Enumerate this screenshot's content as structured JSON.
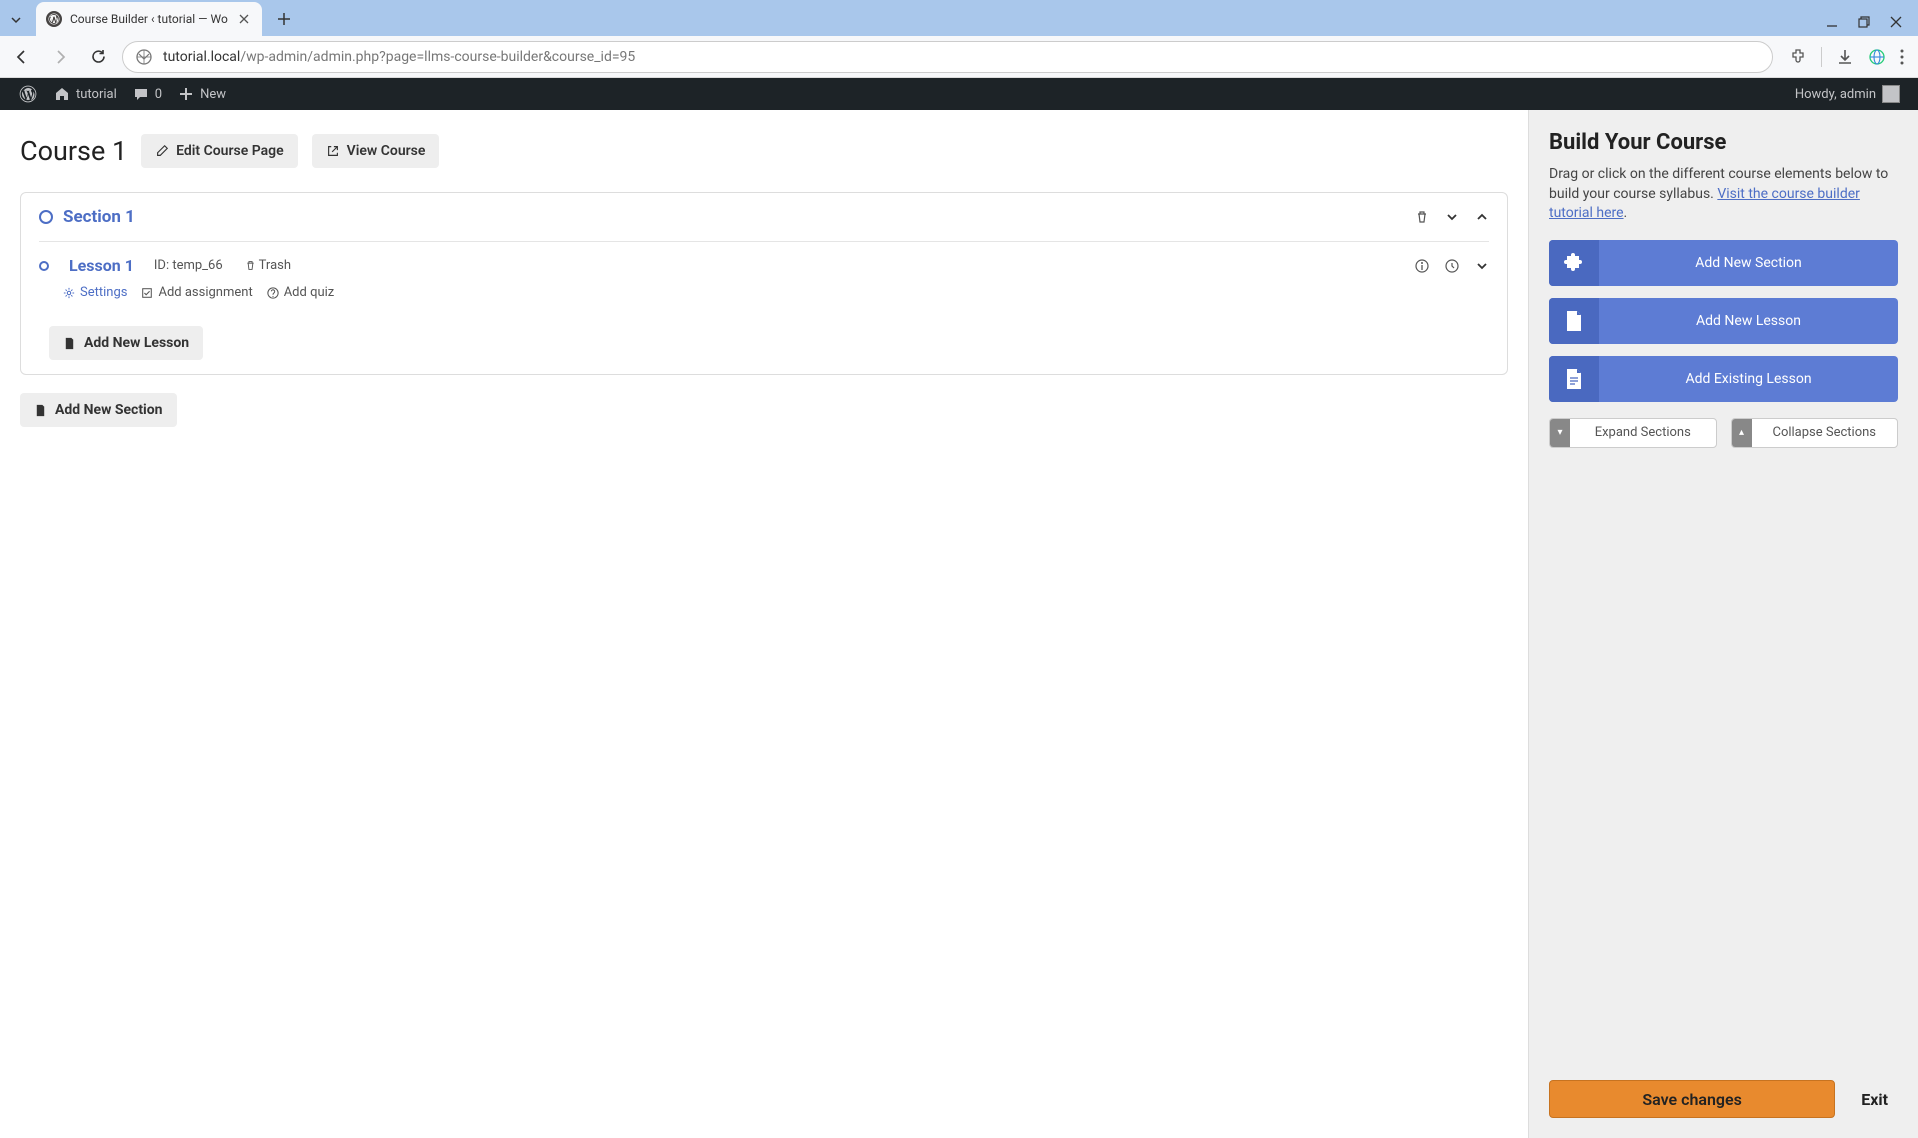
{
  "browser": {
    "tab_title": "Course Builder ‹ tutorial — Wo",
    "url_host": "tutorial.local",
    "url_path": "/wp-admin/admin.php?page=llms-course-builder&course_id=95"
  },
  "wp_adminbar": {
    "site_name": "tutorial",
    "comments_count": "0",
    "new_label": "New",
    "howdy": "Howdy, admin"
  },
  "header": {
    "course_title": "Course 1",
    "edit_btn": "Edit Course Page",
    "view_btn": "View Course"
  },
  "section": {
    "title": "Section 1",
    "lesson": {
      "title": "Lesson 1",
      "id_label": "ID: temp_66",
      "trash": "Trash",
      "settings": "Settings",
      "add_assignment": "Add assignment",
      "add_quiz": "Add quiz"
    },
    "add_lesson_inside": "Add New Lesson"
  },
  "add_section_btn": "Add New Section",
  "sidebar": {
    "title": "Build Your Course",
    "desc_prefix": "Drag or click on the different course elements below to build your course syllabus. ",
    "desc_link": "Visit the course builder tutorial here",
    "desc_suffix": ".",
    "add_section": "Add New Section",
    "add_lesson": "Add New Lesson",
    "add_existing": "Add Existing Lesson",
    "expand": "Expand Sections",
    "collapse": "Collapse Sections",
    "save": "Save changes",
    "exit": "Exit"
  }
}
